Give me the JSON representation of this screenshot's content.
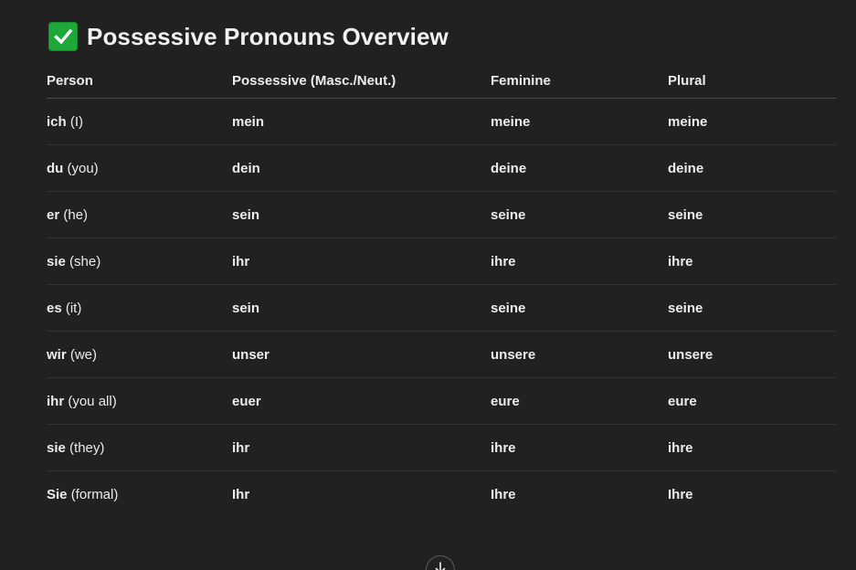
{
  "heading": {
    "icon": "check-mark-button-icon",
    "icon_color": "#1fa83a",
    "title": "Possessive Pronouns Overview"
  },
  "table": {
    "headers": [
      "Person",
      "Possessive (Masc./Neut.)",
      "Feminine",
      "Plural"
    ],
    "rows": [
      {
        "person": "ich",
        "gloss": "(I)",
        "possessive": "mein",
        "feminine": "meine",
        "plural": "meine"
      },
      {
        "person": "du",
        "gloss": "(you)",
        "possessive": "dein",
        "feminine": "deine",
        "plural": "deine"
      },
      {
        "person": "er",
        "gloss": "(he)",
        "possessive": "sein",
        "feminine": "seine",
        "plural": "seine"
      },
      {
        "person": "sie",
        "gloss": "(she)",
        "possessive": "ihr",
        "feminine": "ihre",
        "plural": "ihre"
      },
      {
        "person": "es",
        "gloss": "(it)",
        "possessive": "sein",
        "feminine": "seine",
        "plural": "seine"
      },
      {
        "person": "wir",
        "gloss": "(we)",
        "possessive": "unser",
        "feminine": "unsere",
        "plural": "unsere"
      },
      {
        "person": "ihr",
        "gloss": "(you all)",
        "possessive": "euer",
        "feminine": "eure",
        "plural": "eure"
      },
      {
        "person": "sie",
        "gloss": "(they)",
        "possessive": "ihr",
        "feminine": "ihre",
        "plural": "ihre"
      },
      {
        "person": "Sie",
        "gloss": "(formal)",
        "possessive": "Ihr",
        "feminine": "Ihre",
        "plural": "Ihre"
      }
    ]
  },
  "scroll_button": {
    "icon": "arrow-down-icon"
  }
}
